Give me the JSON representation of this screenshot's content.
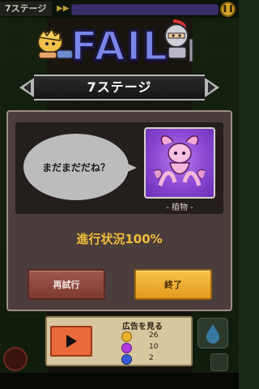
{
  "topbar": {
    "stage_label": "7ステージ",
    "fast_forward_icon": "fast-forward-icon",
    "pause_icon": "pause-icon"
  },
  "result": {
    "title": "FAIL",
    "stage_banner": "7ステージ"
  },
  "dialog": {
    "speech": "まだまだだね？",
    "unit_type": "- 植物 -",
    "progress": "進行状況100%",
    "retry_label": "再試行",
    "end_label": "終了"
  },
  "ad": {
    "title": "広告を見る",
    "rewards": [
      {
        "icon": "gold-coin-icon",
        "amount": "26"
      },
      {
        "icon": "purple-gem-icon",
        "amount": "10"
      },
      {
        "icon": "blue-orb-icon",
        "amount": "2"
      }
    ]
  },
  "colors": {
    "fail_title": "#7b86e8",
    "progress_text": "#f0bf3a",
    "retry_button": "#8f4840",
    "end_button": "#f0b030",
    "dialog_bg": "#4a3d3b",
    "portrait_bg": "#8a47d2"
  }
}
